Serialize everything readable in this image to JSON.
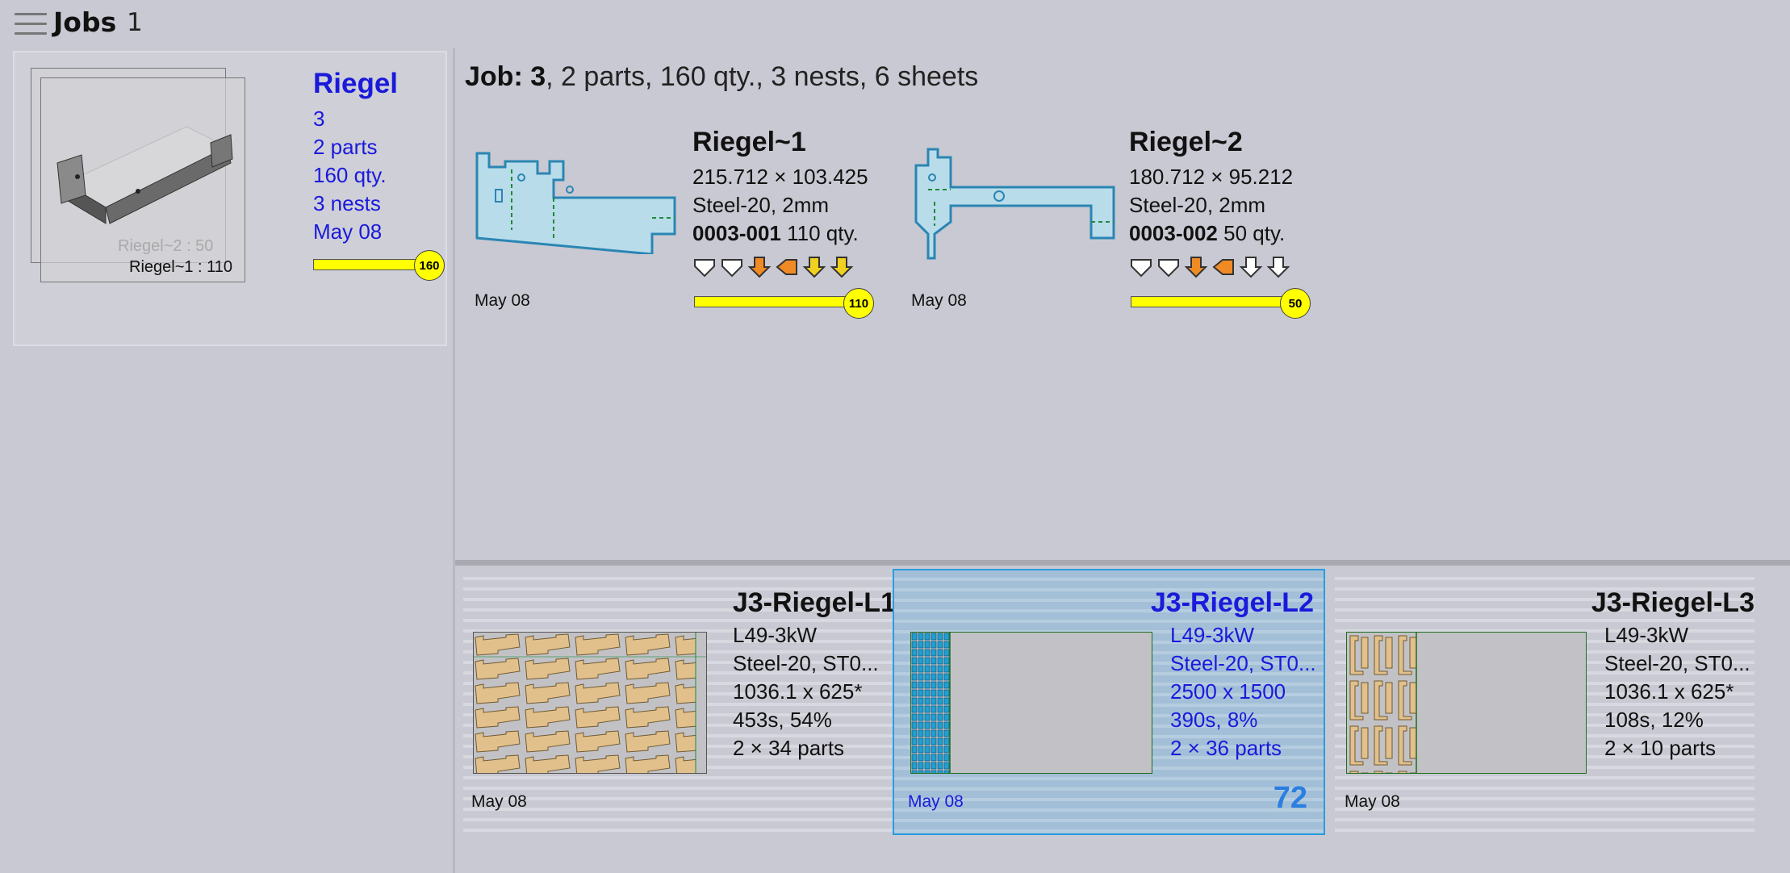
{
  "header": {
    "title": "Jobs",
    "count": "1"
  },
  "job_card": {
    "name": "Riegel",
    "lines": [
      "3",
      "2 parts",
      "160 qty.",
      "3 nests",
      "May 08"
    ],
    "progress_value": "160",
    "progress_fraction": 1.0,
    "thumb_caption_back": "Riegel~2 : 50",
    "thumb_caption_front": "Riegel~1 : 110"
  },
  "summary": {
    "job_label": "Job:",
    "job_number": "3",
    "rest": ", 2 parts, 160 qty., 3 nests, 6 sheets"
  },
  "parts": [
    {
      "name": "Riegel~1",
      "dims": "215.712 × 103.425",
      "material": "Steel-20, 2mm",
      "code": "0003-001",
      "qty": "110 qty.",
      "date": "May 08",
      "progress_value": "110",
      "progress_fraction": 1.0,
      "ops": [
        "white",
        "white",
        "orange",
        "orange-left",
        "yellow",
        "yellow"
      ]
    },
    {
      "name": "Riegel~2",
      "dims": "180.712 × 95.212",
      "material": "Steel-20, 2mm",
      "code": "0003-002",
      "qty": "50 qty.",
      "date": "May 08",
      "progress_value": "50",
      "progress_fraction": 1.0,
      "ops": [
        "white",
        "white",
        "orange",
        "orange-left",
        "white",
        "white"
      ]
    }
  ],
  "nests": [
    {
      "name": "J3-Riegel-L1",
      "machine": "L49-3kW",
      "material": "Steel-20, ST0...",
      "size": "1036.1 x 625*",
      "time": "453s, 54%",
      "parts": "2 × 34 parts",
      "date": "May 08",
      "selected": false,
      "fill_fraction": 1.0
    },
    {
      "name": "J3-Riegel-L2",
      "machine": "L49-3kW",
      "material": "Steel-20, ST0...",
      "size": "2500 x 1500",
      "time": "390s, 8%",
      "parts": "2 × 36 parts",
      "date": "May 08",
      "selected": true,
      "badge": "72",
      "fill_fraction": 0.12
    },
    {
      "name": "J3-Riegel-L3",
      "machine": "L49-3kW",
      "material": "Steel-20, ST0...",
      "size": "1036.1 x 625*",
      "time": "108s, 12%",
      "parts": "2 × 10 parts",
      "date": "May 08",
      "selected": false,
      "fill_fraction": 0.22
    }
  ],
  "colors": {
    "accent": "#1a1adb",
    "progress": "#ffff00",
    "part_fill": "#b9dcea",
    "part_stroke": "#2a86b3",
    "nest_part": "#e2c08c",
    "selection": "#2a9de0"
  }
}
